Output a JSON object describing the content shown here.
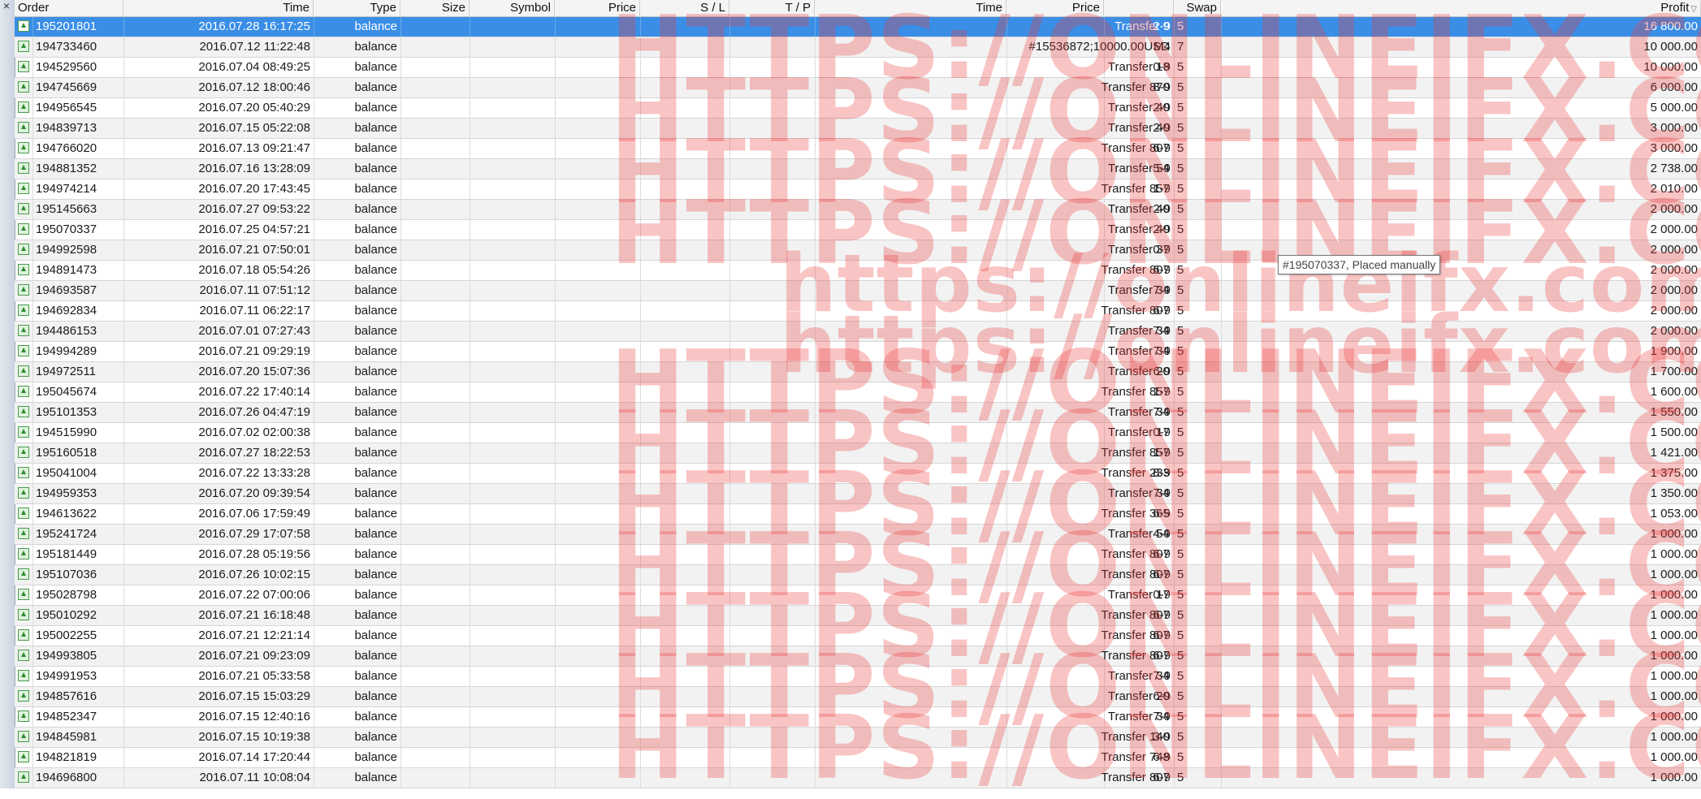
{
  "window": {
    "close_glyph": "×"
  },
  "columns": [
    {
      "key": "order",
      "label": "Order"
    },
    {
      "key": "time",
      "label": "Time"
    },
    {
      "key": "type",
      "label": "Type"
    },
    {
      "key": "size",
      "label": "Size"
    },
    {
      "key": "symbol",
      "label": "Symbol"
    },
    {
      "key": "price",
      "label": "Price"
    },
    {
      "key": "sl",
      "label": "S / L"
    },
    {
      "key": "tp",
      "label": "T / P"
    },
    {
      "key": "time2",
      "label": "Time"
    },
    {
      "key": "price2",
      "label": "Price"
    },
    {
      "key": "comment",
      "label": ""
    },
    {
      "key": "swap",
      "label": "Swap"
    },
    {
      "key": "profit",
      "label": "Profit"
    }
  ],
  "sort": {
    "column": "profit",
    "icon": "sort-desc-icon",
    "glyph": "▽"
  },
  "row_icon": "balance-arrow-up-icon",
  "selected_row": 0,
  "rows": [
    {
      "order": "195201801",
      "time": "2016.07.28 16:17:25",
      "type": "balance",
      "price2": "Transfer 9",
      "c1": "2-9",
      "c2": "5",
      "profit": "16 800.00"
    },
    {
      "order": "194733460",
      "time": "2016.07.12 11:22:48",
      "type": "balance",
      "price2": "#15536872;10000.00USD",
      "c1": "M4",
      "c2": "7",
      "profit": "10 000.00"
    },
    {
      "order": "194529560",
      "time": "2016.07.04 08:49:25",
      "type": "balance",
      "price2": "Transfer 18",
      "c1": "0-9",
      "c2": "5",
      "profit": "10 000.00"
    },
    {
      "order": "194745669",
      "time": "2016.07.12 18:00:46",
      "type": "balance",
      "price2": "Transfer 870",
      "c1": "8-9",
      "c2": "5",
      "profit": "6 000.00"
    },
    {
      "order": "194956545",
      "time": "2016.07.20 05:40:29",
      "type": "balance",
      "price2": "Transfer 40",
      "c1": "2-9",
      "c2": "5",
      "profit": "5 000.00"
    },
    {
      "order": "194839713",
      "time": "2016.07.15 05:22:08",
      "type": "balance",
      "price2": "Transfer 40",
      "c1": "2-9",
      "c2": "5",
      "profit": "3 000.00"
    },
    {
      "order": "194766020",
      "time": "2016.07.13 09:21:47",
      "type": "balance",
      "price2": "Transfer 807",
      "c1": "6-9",
      "c2": "5",
      "profit": "3 000.00"
    },
    {
      "order": "194881352",
      "time": "2016.07.16 13:28:09",
      "type": "balance",
      "price2": "Transfer 54",
      "c1": "5-9",
      "c2": "5",
      "profit": "2 738.00"
    },
    {
      "order": "194974214",
      "time": "2016.07.20 17:43:45",
      "type": "balance",
      "price2": "Transfer 857",
      "c1": "1-9",
      "c2": "5",
      "profit": "2 010.00"
    },
    {
      "order": "195145663",
      "time": "2016.07.27 09:53:22",
      "type": "balance",
      "price2": "Transfer 40",
      "c1": "2-9",
      "c2": "5",
      "profit": "2 000.00"
    },
    {
      "order": "195070337",
      "time": "2016.07.25 04:57:21",
      "type": "balance",
      "price2": "Transfer 40",
      "c1": "2-9",
      "c2": "5",
      "profit": "2 000.00"
    },
    {
      "order": "194992598",
      "time": "2016.07.21 07:50:01",
      "type": "balance",
      "price2": "Transfer 37",
      "c1": "0-9",
      "c2": "5",
      "profit": "2 000.00"
    },
    {
      "order": "194891473",
      "time": "2016.07.18 05:54:26",
      "type": "balance",
      "price2": "Transfer 807",
      "c1": "6-9",
      "c2": "5",
      "profit": "2 000.00"
    },
    {
      "order": "194693587",
      "time": "2016.07.11 07:51:12",
      "type": "balance",
      "price2": "Transfer 34",
      "c1": "7-9",
      "c2": "5",
      "profit": "2 000.00"
    },
    {
      "order": "194692834",
      "time": "2016.07.11 06:22:17",
      "type": "balance",
      "price2": "Transfer 807",
      "c1": "6-9",
      "c2": "5",
      "profit": "2 000.00"
    },
    {
      "order": "194486153",
      "time": "2016.07.01 07:27:43",
      "type": "balance",
      "price2": "Transfer 34",
      "c1": "7-9",
      "c2": "5",
      "profit": "2 000.00"
    },
    {
      "order": "194994289",
      "time": "2016.07.21 09:29:19",
      "type": "balance",
      "price2": "Transfer 34",
      "c1": "7-9",
      "c2": "5",
      "profit": "1 900.00"
    },
    {
      "order": "194972511",
      "time": "2016.07.20 15:07:36",
      "type": "balance",
      "price2": "Transfer 20",
      "c1": "6-9",
      "c2": "5",
      "profit": "1 700.00"
    },
    {
      "order": "195045674",
      "time": "2016.07.22 17:40:14",
      "type": "balance",
      "price2": "Transfer 857",
      "c1": "1-9",
      "c2": "5",
      "profit": "1 600.00"
    },
    {
      "order": "195101353",
      "time": "2016.07.26 04:47:19",
      "type": "balance",
      "price2": "Transfer 34",
      "c1": "7-9",
      "c2": "5",
      "profit": "1 550.00"
    },
    {
      "order": "194515990",
      "time": "2016.07.02 02:00:38",
      "type": "balance",
      "price2": "Transfer 17",
      "c1": "0-9",
      "c2": "5",
      "profit": "1 500.00"
    },
    {
      "order": "195160518",
      "time": "2016.07.27 18:22:53",
      "type": "balance",
      "price2": "Transfer 857",
      "c1": "1-9",
      "c2": "5",
      "profit": "1 421.00"
    },
    {
      "order": "195041004",
      "time": "2016.07.22 13:33:28",
      "type": "balance",
      "price2": "Transfer 233",
      "c1": "8-9",
      "c2": "5",
      "profit": "1 375.00"
    },
    {
      "order": "194959353",
      "time": "2016.07.20 09:39:54",
      "type": "balance",
      "price2": "Transfer 34",
      "c1": "7-9",
      "c2": "5",
      "profit": "1 350.00"
    },
    {
      "order": "194613622",
      "time": "2016.07.06 17:59:49",
      "type": "balance",
      "price2": "Transfer 365",
      "c1": "6-9",
      "c2": "5",
      "profit": "1 053.00"
    },
    {
      "order": "195241724",
      "time": "2016.07.29 17:07:58",
      "type": "balance",
      "price2": "Transfer 54",
      "c1": "4-9",
      "c2": "5",
      "profit": "1 000.00"
    },
    {
      "order": "195181449",
      "time": "2016.07.28 05:19:56",
      "type": "balance",
      "price2": "Transfer 807",
      "c1": "6-9",
      "c2": "5",
      "profit": "1 000.00"
    },
    {
      "order": "195107036",
      "time": "2016.07.26 10:02:15",
      "type": "balance",
      "price2": "Transfer 807",
      "c1": "6-9",
      "c2": "5",
      "profit": "1 000.00"
    },
    {
      "order": "195028798",
      "time": "2016.07.22 07:00:06",
      "type": "balance",
      "price2": "Transfer 17",
      "c1": "0-9",
      "c2": "5",
      "profit": "1 000.00"
    },
    {
      "order": "195010292",
      "time": "2016.07.21 16:18:48",
      "type": "balance",
      "price2": "Transfer 807",
      "c1": "6-9",
      "c2": "5",
      "profit": "1 000.00"
    },
    {
      "order": "195002255",
      "time": "2016.07.21 12:21:14",
      "type": "balance",
      "price2": "Transfer 807",
      "c1": "6-9",
      "c2": "5",
      "profit": "1 000.00"
    },
    {
      "order": "194993805",
      "time": "2016.07.21 09:23:09",
      "type": "balance",
      "price2": "Transfer 807",
      "c1": "6-9",
      "c2": "5",
      "profit": "1 000.00"
    },
    {
      "order": "194991953",
      "time": "2016.07.21 05:33:58",
      "type": "balance",
      "price2": "Transfer 34",
      "c1": "7-9",
      "c2": "5",
      "profit": "1 000.00"
    },
    {
      "order": "194857616",
      "time": "2016.07.15 15:03:29",
      "type": "balance",
      "price2": "Transfer 20",
      "c1": "6-9",
      "c2": "5",
      "profit": "1 000.00"
    },
    {
      "order": "194852347",
      "time": "2016.07.15 12:40:16",
      "type": "balance",
      "price2": "Transfer 34",
      "c1": "7-9",
      "c2": "5",
      "profit": "1 000.00"
    },
    {
      "order": "194845981",
      "time": "2016.07.15 10:19:38",
      "type": "balance",
      "price2": "Transfer 140",
      "c1": "3-9",
      "c2": "5",
      "profit": "1 000.00"
    },
    {
      "order": "194821819",
      "time": "2016.07.14 17:20:44",
      "type": "balance",
      "price2": "Transfer 748",
      "c1": "6-9",
      "c2": "5",
      "profit": "1 000.00"
    },
    {
      "order": "194696800",
      "time": "2016.07.11 10:08:04",
      "type": "balance",
      "price2": "Transfer 807",
      "c1": "6-9",
      "c2": "5",
      "profit": "1 000.00"
    }
  ],
  "tooltip": {
    "text": "#195070337, Placed manually"
  },
  "watermark": {
    "upper": "HTTPS://ONLINEIFX.COM",
    "lower": "https://onlineifx.com"
  },
  "colors": {
    "selection": "#3a8ee6",
    "watermark": "#eb3c3c",
    "icon_green": "#2e8b2e"
  }
}
